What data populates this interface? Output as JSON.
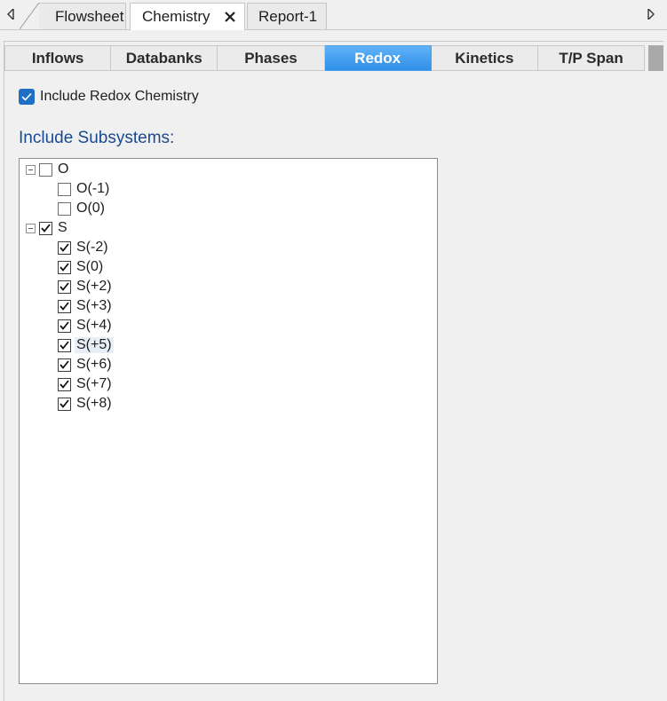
{
  "doc_tabs": {
    "flowsheet": "Flowsheet",
    "chemistry": "Chemistry",
    "report": "Report-1"
  },
  "sub_tabs": [
    "Inflows",
    "Databanks",
    "Phases",
    "Redox",
    "Kinetics",
    "T/P Span"
  ],
  "active_sub_tab": "Redox",
  "redox_checkbox": {
    "label": "Include Redox Chemistry",
    "checked": true
  },
  "subsystems_title": "Include Subsystems:",
  "tree": {
    "groups": [
      {
        "label": "O",
        "checked": false,
        "expanded": true,
        "children": [
          {
            "label": "O(-1)",
            "checked": false
          },
          {
            "label": "O(0)",
            "checked": false
          }
        ]
      },
      {
        "label": "S",
        "checked": true,
        "expanded": true,
        "children": [
          {
            "label": "S(-2)",
            "checked": true
          },
          {
            "label": "S(0)",
            "checked": true
          },
          {
            "label": "S(+2)",
            "checked": true
          },
          {
            "label": "S(+3)",
            "checked": true
          },
          {
            "label": "S(+4)",
            "checked": true
          },
          {
            "label": "S(+5)",
            "checked": true
          },
          {
            "label": "S(+6)",
            "checked": true
          },
          {
            "label": "S(+7)",
            "checked": true
          },
          {
            "label": "S(+8)",
            "checked": true
          }
        ]
      }
    ]
  },
  "colors": {
    "active_tab": "#3a97ec",
    "title_blue": "#1a4a8e",
    "checkbox_blue": "#1f6fc6"
  }
}
